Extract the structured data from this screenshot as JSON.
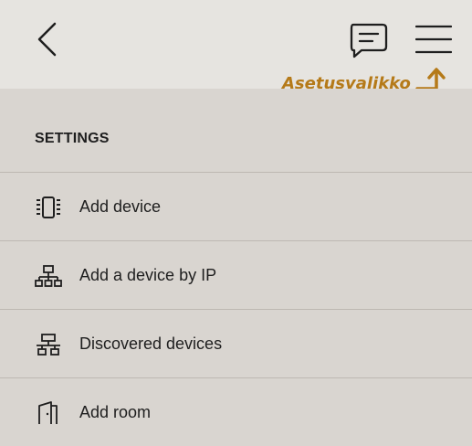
{
  "header": {
    "back_icon": "chevron-left-icon",
    "chat_icon": "message-icon",
    "menu_icon": "hamburger-menu-icon",
    "annotation": "Asetusvalikko",
    "annotation_color": "#b57a19"
  },
  "settings": {
    "title": "SETTINGS",
    "items": [
      {
        "label": "Add device",
        "icon": "device-icon"
      },
      {
        "label": "Add a device by IP",
        "icon": "network-icon"
      },
      {
        "label": "Discovered devices",
        "icon": "discovered-network-icon"
      },
      {
        "label": "Add room",
        "icon": "room-icon"
      }
    ]
  },
  "colors": {
    "header_bg": "#e6e4e0",
    "panel_bg": "#d9d5d0",
    "divider": "#bdb8b2",
    "text": "#1e1e1e"
  }
}
